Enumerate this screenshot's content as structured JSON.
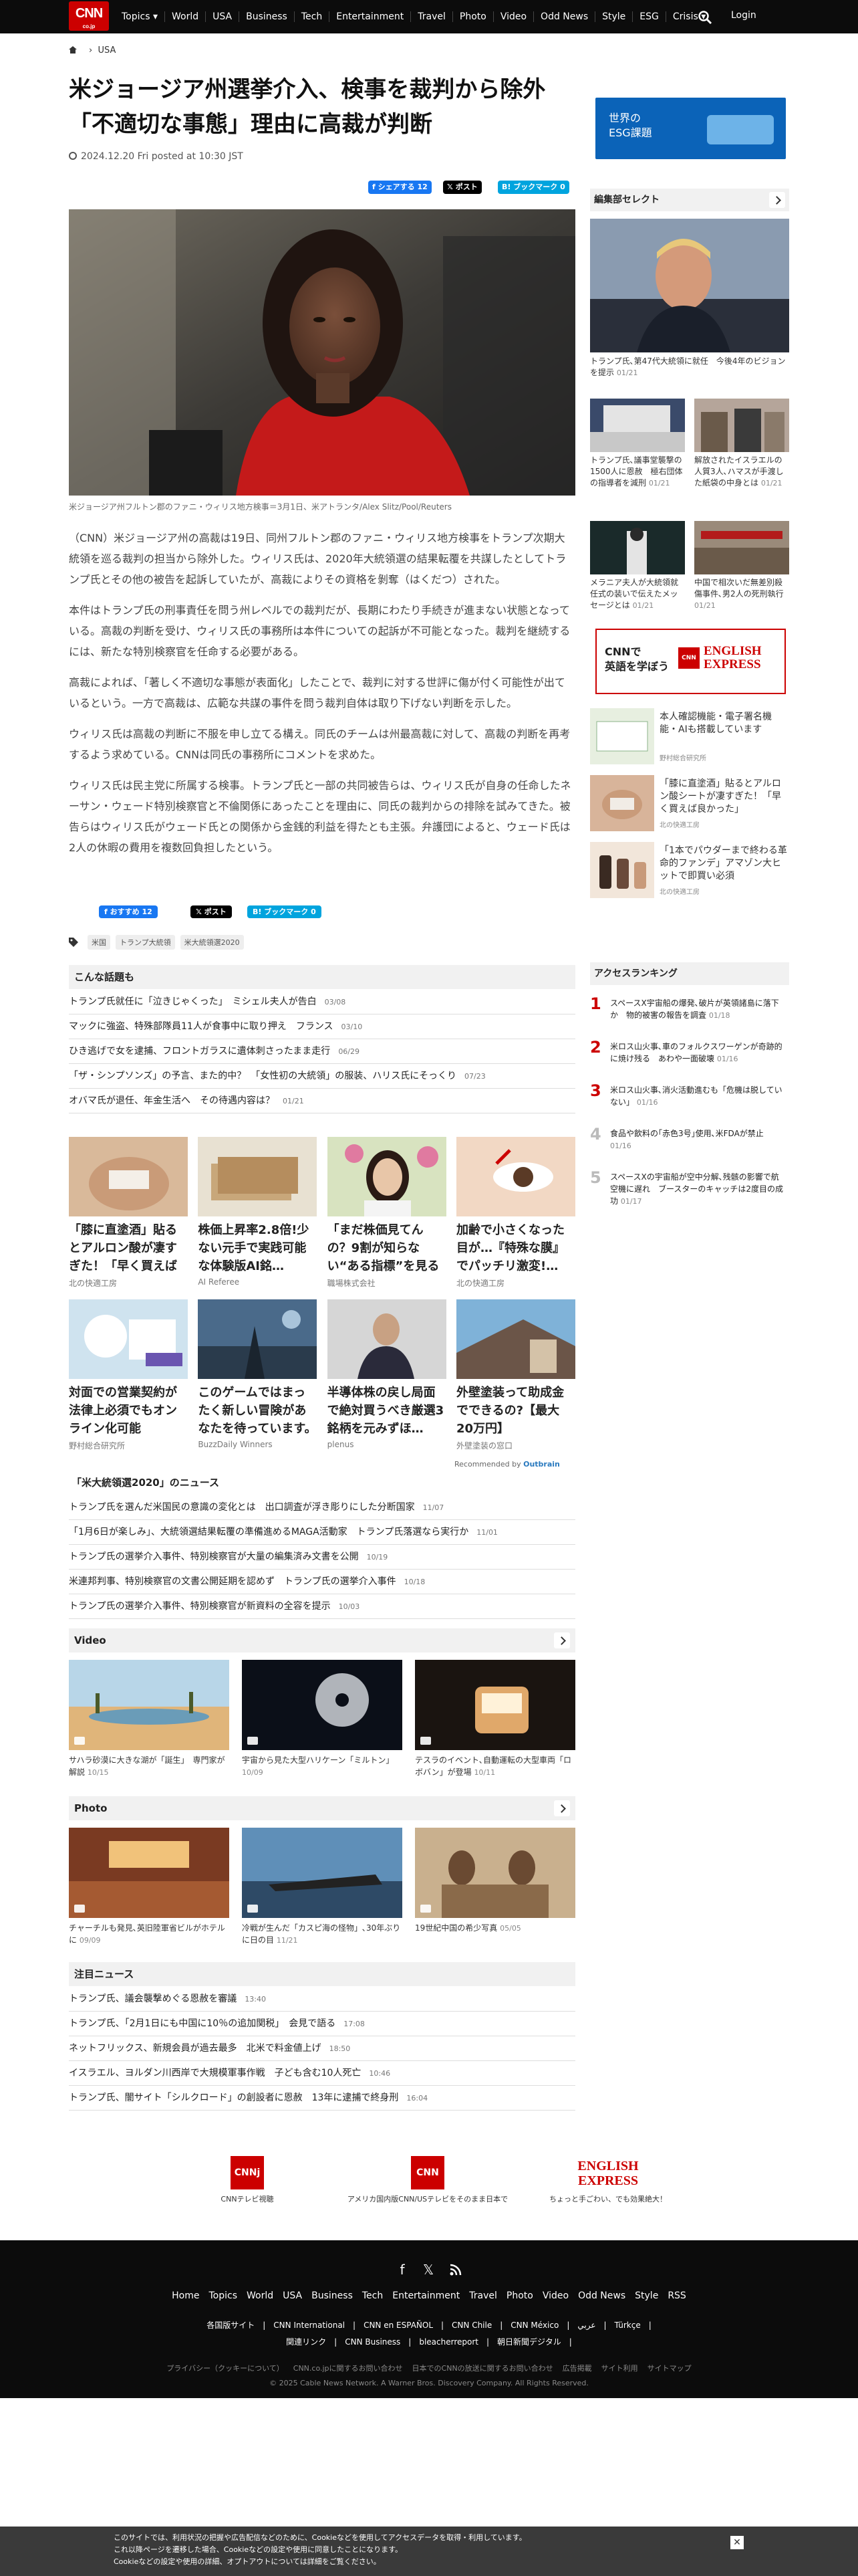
{
  "header": {
    "logo": "CNN",
    "logo_sub": "co.jp",
    "nav": [
      "Topics",
      "World",
      "USA",
      "Business",
      "Tech",
      "Entertainment",
      "Travel",
      "Photo",
      "Video",
      "Odd News",
      "Style",
      "ESG",
      "Crisis"
    ],
    "login": "Login"
  },
  "breadcrumb": {
    "section": "USA"
  },
  "article": {
    "title": "米ジョージア州選挙介入、検事を裁判から除外　「不適切な事態」理由に高裁が判断",
    "date": "2024.12.20 Fri posted at 10:30 JST",
    "share_facebook": "シェアする 12",
    "share_x": "ポスト",
    "share_hatena": "ブックマーク 0",
    "share_facebook2": "おすすめ 12",
    "share_x2": "ポスト",
    "share_hatena2": "ブックマーク 0",
    "caption": "米ジョージア州フルトン郡のファニ・ウィリス地方検事＝3月1日、米アトランタ/Alex Slitz/Pool/Reuters",
    "paragraphs": [
      "（CNN）米ジョージア州の高裁は19日、同州フルトン郡のファニ・ウィリス地方検事をトランプ次期大統領を巡る裁判の担当から除外した。ウィリス氏は、2020年大統領選の結果転覆を共謀したとしてトランプ氏とその他の被告を起訴していたが、高裁によりその資格を剝奪（はくだつ）された。",
      "本件はトランプ氏の刑事責任を問う州レベルでの裁判だが、長期にわたり手続きが進まない状態となっている。高裁の判断を受け、ウィリス氏の事務所は本件についての起訴が不可能となった。裁判を継続するには、新たな特別検察官を任命する必要がある。",
      "高裁によれば、「著しく不適切な事態が表面化」したことで、裁判に対する世評に傷が付く可能性が出ているという。一方で高裁は、広範な共謀の事件を問う裁判自体は取り下げない判断を示した。",
      "ウィリス氏は高裁の判断に不服を申し立てる構え。同氏のチームは州最高裁に対して、高裁の判断を再考するよう求めている。CNNは同氏の事務所にコメントを求めた。",
      "ウィリス氏は民主党に所属する検事。トランプ氏と一部の共同被告らは、ウィリス氏が自身の任命したネーサン・ウェード特別検察官と不倫関係にあったことを理由に、同氏の裁判からの排除を試みてきた。被告らはウィリス氏がウェード氏との関係から金銭的利益を得たとも主張。弁護団によると、ウェード氏は2人の休暇の費用を複数回負担したという。"
    ],
    "tags": [
      "米国",
      "トランプ大統領",
      "米大統領選2020"
    ]
  },
  "related": {
    "title": "こんな話題も",
    "items": [
      {
        "t": "トランプ氏就任に「泣きじゃくった」　ミシェル夫人が告白",
        "d": "03/08"
      },
      {
        "t": "マックに強盗、特殊部隊員11人が食事中に取り押え　フランス",
        "d": "03/10"
      },
      {
        "t": "ひき逃げで女を逮捕、フロントガラスに遺体刺さったまま走行",
        "d": "06/29"
      },
      {
        "t": "「ザ・シンプソンズ」の予言、また的中？　「女性初の大統領」の服装、ハリス氏にそっくり",
        "d": "07/23"
      },
      {
        "t": "オバマ氏が退任、年金生活へ　その待遇内容は？",
        "d": "01/21"
      }
    ]
  },
  "ads": {
    "row1": [
      {
        "t": "「膝に直塗酒」貼るとアルロン酸が凄すぎた！「早く買えば良…",
        "s": "北の快適工房"
      },
      {
        "t": "株価上昇率2.8倍!少ない元手で実践可能な体験版AI銘…",
        "s": "AI Referee"
      },
      {
        "t": "「まだ株価見てんの？9割が知らない“ある指標”を見るだ…",
        "s": "職場株式会社"
      },
      {
        "t": "加齢で小さくなった目が…『特殊な膜』でパッチリ激変!…",
        "s": "北の快適工房"
      }
    ],
    "row2": [
      {
        "t": "対面での営業契約が法律上必須でもオンライン化可能",
        "s": "野村総合研究所"
      },
      {
        "t": "このゲームではまったく新しい冒険があなたを待っています。",
        "s": "BuzzDaily Winners"
      },
      {
        "t": "半導体株の戻し局面で絶対買うべき厳選3銘柄を元みずほ…",
        "s": "plenus"
      },
      {
        "t": "外壁塗装って助成金でできるの?【最大20万円】",
        "s": "外壁塗装の窓口"
      }
    ],
    "recommended": "Recommended by",
    "outbrain": "Outbrain"
  },
  "election_news": {
    "title": "「米大統領選2020」のニュース",
    "items": [
      {
        "t": "トランプ氏を選んだ米国民の意識の変化とは　出口調査が浮き彫りにした分断国家",
        "d": "11/07"
      },
      {
        "t": "「1月6日が楽しみ」、大統領選結果転覆の準備進めるMAGA活動家　トランプ氏落選なら実行か",
        "d": "11/01"
      },
      {
        "t": "トランプ氏の選挙介入事件、特別検察官が大量の編集済み文書を公開",
        "d": "10/19"
      },
      {
        "t": "米連邦判事、特別検察官の文書公開延期を認めず　トランプ氏の選挙介入事件",
        "d": "10/18"
      },
      {
        "t": "トランプ氏の選挙介入事件、特別検察官が新資料の全容を提示",
        "d": "10/03"
      }
    ]
  },
  "video": {
    "title": "Video",
    "items": [
      {
        "t": "サハラ砂漠に大きな湖が「誕生」　専門家が解説",
        "d": "10/15"
      },
      {
        "t": "宇宙から見た大型ハリケーン「ミルトン」",
        "d": "10/09"
      },
      {
        "t": "テスラのイベント､自動運転の大型車両「ロボバン」が登場",
        "d": "10/11"
      }
    ]
  },
  "photo": {
    "title": "Photo",
    "items": [
      {
        "t": "チャーチルも発見､英旧陸軍省ビルがホテルに",
        "d": "09/09"
      },
      {
        "t": "冷戦が生んだ「カスピ海の怪物」､30年ぶりに日の目",
        "d": "11/21"
      },
      {
        "t": "19世紀中国の希少写真",
        "d": "05/05"
      }
    ]
  },
  "attention": {
    "title": "注目ニュース",
    "items": [
      {
        "t": "トランプ氏、議会襲撃めぐる恩赦を審議",
        "d": "13:40"
      },
      {
        "t": "トランプ氏、「2月1日にも中国に10％の追加関税」　会見で語る",
        "d": "17:08"
      },
      {
        "t": "ネットフリックス、新規会員が過去最多　北米で料金値上げ",
        "d": "18:50"
      },
      {
        "t": "イスラエル、ヨルダン川西岸で大規模軍事作戦　子ども含む10人死亡",
        "d": "10:46"
      },
      {
        "t": "トランプ氏、闇サイト「シルクロード」の創設者に恩赦　13年に逮捕で終身刑",
        "d": "16:04"
      }
    ]
  },
  "sidebar": {
    "esg_banner": "世界の\nESG課題",
    "editor_title": "編集部セレクト",
    "editor_main": {
      "t": "トランプ氏､第47代大統領に就任　今後4年のビジョンを提示",
      "d": "01/21"
    },
    "editor_items": [
      {
        "t": "トランプ氏､議事堂襲撃の1500人に恩赦　極右団体の指導者を減刑",
        "d": "01/21"
      },
      {
        "t": "解放されたイスラエルの人質3人､ハマスが手渡した紙袋の中身とは",
        "d": "01/21"
      },
      {
        "t": "メラニア夫人が大統領就任式の装いで伝えたメッセージとは",
        "d": "01/21"
      },
      {
        "t": "中国で相次いだ無差別殺傷事件､男2人の死刑執行",
        "d": "01/21"
      }
    ],
    "english_banner": {
      "line1": "CNNで",
      "line2": "英語を学ぼう",
      "brand": "ENGLISH EXPRESS"
    },
    "promos": [
      {
        "t": "本人確認機能・電子署名機能・AIも搭載しています",
        "s": "野村総合研究所"
      },
      {
        "t": "「膝に直塗酒」貼るとアルロン酸シートが凄すぎた！「早く買えば良かった」",
        "s": "北の快適工房"
      },
      {
        "t": "「1本でパウダーまで終わる革命的ファンデ」アマゾン大ヒットで即買い必須",
        "s": "北の快適工房"
      }
    ],
    "ranking_title": "アクセスランキング",
    "ranking": [
      {
        "n": "1",
        "t": "スペースX宇宙船の爆発､破片が英領諸島に落下か　物的被害の報告を調査",
        "d": "01/18"
      },
      {
        "n": "2",
        "t": "米ロス山火事､車のフォルクスワーゲンが奇跡的に焼け残る　あわや一面破壊",
        "d": "01/16"
      },
      {
        "n": "3",
        "t": "米ロス山火事､消火活動進むも「危機は脱していない」",
        "d": "01/16"
      },
      {
        "n": "4",
        "t": "食品や飲料の｢赤色3号｣使用､米FDAが禁止",
        "d": "01/16"
      },
      {
        "n": "5",
        "t": "スペースXの宇宙船が空中分解､残骸の影響で航空機に遅れ　ブースターのキャッチは2度目の成功",
        "d": "01/17"
      }
    ]
  },
  "footer": {
    "logos": [
      {
        "name": "CNNj",
        "label": "CNNテレビ視聴"
      },
      {
        "name": "CNN",
        "label": "アメリカ国内版CNN/USテレビをそのまま日本で"
      },
      {
        "name": "ENGLISH EXPRESS",
        "label": "ちょっと手ごわい、でも効果絶大！"
      }
    ],
    "nav": [
      "Home",
      "Topics",
      "World",
      "USA",
      "Business",
      "Tech",
      "Entertainment",
      "Travel",
      "Photo",
      "Video",
      "Odd News",
      "Style",
      "RSS"
    ],
    "nav2": "各国版サイト　|　CNN International　|　CNN en ESPAÑOL　|　CNN Chile　|　CNN México　|　عربي　|　Türkçe　|",
    "nav2b": "関連リンク　|　CNN Business　|　bleacherreport　|　朝日新聞デジタル　|",
    "nav3": [
      "プライバシー（クッキーについて）",
      "CNN.co.jpに関するお問い合わせ",
      "日本でのCNNの放送に関するお問い合わせ",
      "広告掲載",
      "サイト利用",
      "サイトマップ"
    ],
    "copy": "© 2025 Cable News Network. A Warner Bros. Discovery Company. All Rights Reserved."
  },
  "cookie": {
    "line1": "このサイトでは、利用状況の把握や広告配信などのために、Cookieなどを使用してアクセスデータを取得・利用しています。",
    "line2": "これ以降ページを遷移した場合、Cookieなどの設定や使用に同意したことになります。",
    "line3": "Cookieなどの設定や使用の詳細、オプトアウトについては詳細をご覧ください。"
  }
}
